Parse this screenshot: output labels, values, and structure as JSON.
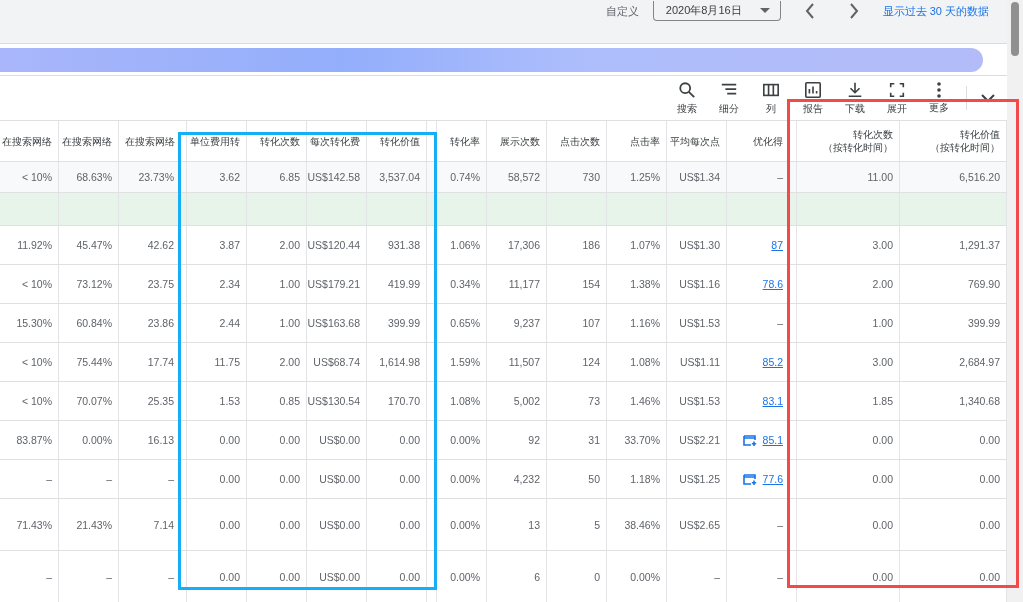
{
  "date_bar": {
    "label": "自定义",
    "date": "2020年8月16日",
    "link": "显示过去 30 天的数据"
  },
  "toolbar": [
    {
      "label": "搜索"
    },
    {
      "label": "细分"
    },
    {
      "label": "列"
    },
    {
      "label": "报告"
    },
    {
      "label": "下载"
    },
    {
      "label": "展开"
    },
    {
      "label": "更多"
    }
  ],
  "table": {
    "columns": [
      {
        "label": "在搜索网络"
      },
      {
        "label": "在搜索网络"
      },
      {
        "label": "在搜索网络"
      },
      {
        "label": "单位费用转"
      },
      {
        "label": "转化次数"
      },
      {
        "label": "每次转化费"
      },
      {
        "label": "转化价值"
      },
      {
        "label": "转化率"
      },
      {
        "label": "展示次数"
      },
      {
        "label": "点击次数"
      },
      {
        "label": "点击率"
      },
      {
        "label": "平均每次点"
      },
      {
        "label": "优化得"
      },
      {
        "label": "转化次数",
        "sub": "（按转化时间）"
      },
      {
        "label": "转化价值",
        "sub": "（按转化时间）"
      }
    ],
    "rows": [
      {
        "kind": "total",
        "cells": [
          "< 10%",
          "68.63%",
          "23.73%",
          "3.62",
          "6.85",
          "US$142.58",
          "3,537.04",
          "0.74%",
          "58,572",
          "730",
          "1.25%",
          "US$1.34",
          "–",
          "11.00",
          "6,516.20"
        ],
        "score_link": false,
        "score_icon": false
      },
      {
        "kind": "group"
      },
      {
        "kind": "data",
        "cells": [
          "11.92%",
          "45.47%",
          "42.62",
          "3.87",
          "2.00",
          "US$120.44",
          "931.38",
          "1.06%",
          "17,306",
          "186",
          "1.07%",
          "US$1.30",
          "87",
          "3.00",
          "1,291.37"
        ],
        "score_link": true,
        "score_icon": false
      },
      {
        "kind": "data",
        "cells": [
          "< 10%",
          "73.12%",
          "23.75",
          "2.34",
          "1.00",
          "US$179.21",
          "419.99",
          "0.34%",
          "11,177",
          "154",
          "1.38%",
          "US$1.16",
          "78.6",
          "2.00",
          "769.90"
        ],
        "score_link": true,
        "score_icon": false
      },
      {
        "kind": "data",
        "cells": [
          "15.30%",
          "60.84%",
          "23.86",
          "2.44",
          "1.00",
          "US$163.68",
          "399.99",
          "0.65%",
          "9,237",
          "107",
          "1.16%",
          "US$1.53",
          "–",
          "1.00",
          "399.99"
        ],
        "score_link": false,
        "score_icon": false
      },
      {
        "kind": "data",
        "cells": [
          "< 10%",
          "75.44%",
          "17.74",
          "11.75",
          "2.00",
          "US$68.74",
          "1,614.98",
          "1.59%",
          "11,507",
          "124",
          "1.08%",
          "US$1.11",
          "85.2",
          "3.00",
          "2,684.97"
        ],
        "score_link": true,
        "score_icon": false
      },
      {
        "kind": "data",
        "cells": [
          "< 10%",
          "70.07%",
          "25.35",
          "1.53",
          "0.85",
          "US$130.54",
          "170.70",
          "1.08%",
          "5,002",
          "73",
          "1.46%",
          "US$1.53",
          "83.1",
          "1.85",
          "1,340.68"
        ],
        "score_link": true,
        "score_icon": false
      },
      {
        "kind": "data",
        "cells": [
          "83.87%",
          "0.00%",
          "16.13",
          "0.00",
          "0.00",
          "US$0.00",
          "0.00",
          "0.00%",
          "92",
          "31",
          "33.70%",
          "US$2.21",
          "85.1",
          "0.00",
          "0.00"
        ],
        "score_link": true,
        "score_icon": true
      },
      {
        "kind": "data",
        "cells": [
          "–",
          "–",
          "–",
          "0.00",
          "0.00",
          "US$0.00",
          "0.00",
          "0.00%",
          "4,232",
          "50",
          "1.18%",
          "US$1.25",
          "77.6",
          "0.00",
          "0.00"
        ],
        "score_link": true,
        "score_icon": true
      },
      {
        "kind": "data",
        "cells": [
          "71.43%",
          "21.43%",
          "7.14",
          "0.00",
          "0.00",
          "US$0.00",
          "0.00",
          "0.00%",
          "13",
          "5",
          "38.46%",
          "US$2.65",
          "–",
          "0.00",
          "0.00"
        ],
        "score_link": false,
        "score_icon": false
      },
      {
        "kind": "data",
        "cells": [
          "–",
          "–",
          "–",
          "0.00",
          "0.00",
          "US$0.00",
          "0.00",
          "0.00%",
          "6",
          "0",
          "0.00%",
          "–",
          "–",
          "0.00",
          "0.00"
        ],
        "score_link": false,
        "score_icon": false
      }
    ]
  },
  "annotations": [
    {
      "color": "#14aff7"
    },
    {
      "color": "#f24a4a"
    }
  ]
}
